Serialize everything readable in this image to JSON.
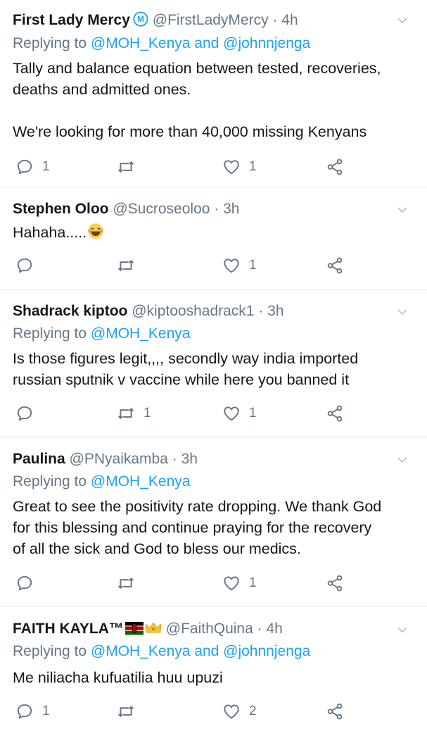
{
  "tweets": [
    {
      "name": "First Lady Mercy",
      "handle": "@FirstLadyMercy",
      "time": "· 4h",
      "replying_prefix": "Replying to",
      "replying_to": "@MOH_Kenya and @johnnjenga",
      "body": "Tally and balance equation between tested, recoveries,\ndeaths and admitted ones.\n\nWe're looking for more than 40,000 missing Kenyans",
      "replies": "1",
      "retweets": "",
      "likes": "1"
    },
    {
      "name": "Stephen Oloo",
      "handle": "@Sucroseoloo",
      "time": "· 3h",
      "body": "Hahaha.....",
      "replies": "",
      "retweets": "",
      "likes": "1"
    },
    {
      "name": "Shadrack kiptoo",
      "handle": "@kiptooshadrack1",
      "time": "· 3h",
      "replying_prefix": "Replying to",
      "replying_to": "@MOH_Kenya",
      "body": "Is those figures legit,,,, secondly way india imported\nrussian sputnik v vaccine while here you banned it",
      "replies": "",
      "retweets": "1",
      "likes": "1"
    },
    {
      "name": "Paulina",
      "handle": "@PNyaikamba",
      "time": "· 3h",
      "replying_prefix": "Replying to",
      "replying_to": "@MOH_Kenya",
      "body": "Great to see the positivity rate dropping. We thank God\nfor this blessing and continue praying for the recovery\nof all the sick and God to bless our medics.",
      "replies": "",
      "retweets": "",
      "likes": "1"
    },
    {
      "name": "FAITH KAYLA™",
      "handle": "@FaithQuina",
      "time": "· 4h",
      "replying_prefix": "Replying to",
      "replying_to": "@MOH_Kenya and @johnnjenga",
      "body": "Me niliacha kufuatilia huu upuzi",
      "replies": "1",
      "retweets": "",
      "likes": "2"
    }
  ],
  "colors": {
    "text": "#14171a",
    "secondary": "#657786",
    "link": "#1da1f2",
    "divider": "#e1e8ed"
  },
  "icons": [
    "reply-icon",
    "retweet-icon",
    "like-icon",
    "share-icon",
    "chevron-down-icon",
    "verified-badge-icon",
    "laughing-emoji-icon",
    "kenya-flag-emoji-icon",
    "crown-emoji-icon"
  ]
}
